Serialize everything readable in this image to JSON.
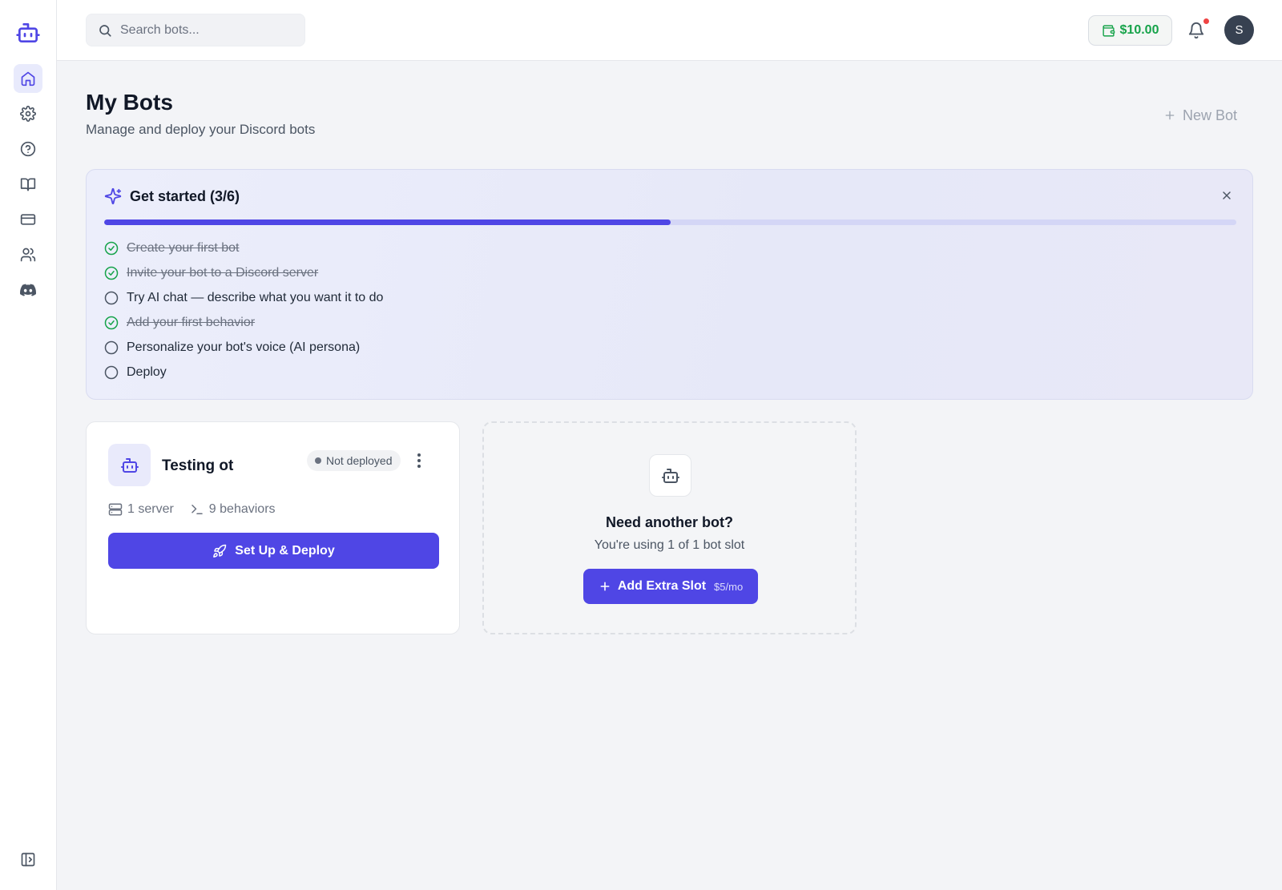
{
  "search": {
    "placeholder": "Search bots..."
  },
  "header": {
    "balance": "$10.00",
    "avatar_initial": "S"
  },
  "sidebar": {
    "items": [
      {
        "icon": "home-icon"
      },
      {
        "icon": "gear-icon"
      },
      {
        "icon": "help-icon"
      },
      {
        "icon": "book-icon"
      },
      {
        "icon": "credit-card-icon"
      },
      {
        "icon": "users-icon"
      },
      {
        "icon": "discord-icon"
      }
    ]
  },
  "page": {
    "title": "My Bots",
    "subtitle": "Manage and deploy your Discord bots",
    "new_bot_label": "New Bot"
  },
  "get_started": {
    "title": "Get started (3/6)",
    "progress": 0.5,
    "steps": [
      {
        "label": "Create your first bot",
        "done": true
      },
      {
        "label": "Invite your bot to a Discord server",
        "done": true
      },
      {
        "label": "Try AI chat — describe what you want it to do",
        "done": false
      },
      {
        "label": "Add your first behavior",
        "done": true
      },
      {
        "label": "Personalize your bot's voice (AI persona)",
        "done": false
      },
      {
        "label": "Deploy",
        "done": false
      }
    ]
  },
  "bot_card": {
    "name": "Testing ot",
    "status": "Not deployed",
    "servers": "1 server",
    "behaviors": "9 behaviors",
    "deploy_label": "Set Up & Deploy"
  },
  "slot_card": {
    "title": "Need another bot?",
    "subtitle": "You're using 1 of 1 bot slot",
    "button_label": "Add Extra Slot",
    "price": "$5/mo"
  },
  "colors": {
    "accent": "#4f46e5",
    "success": "#16a34a",
    "notification": "#ef4444"
  }
}
